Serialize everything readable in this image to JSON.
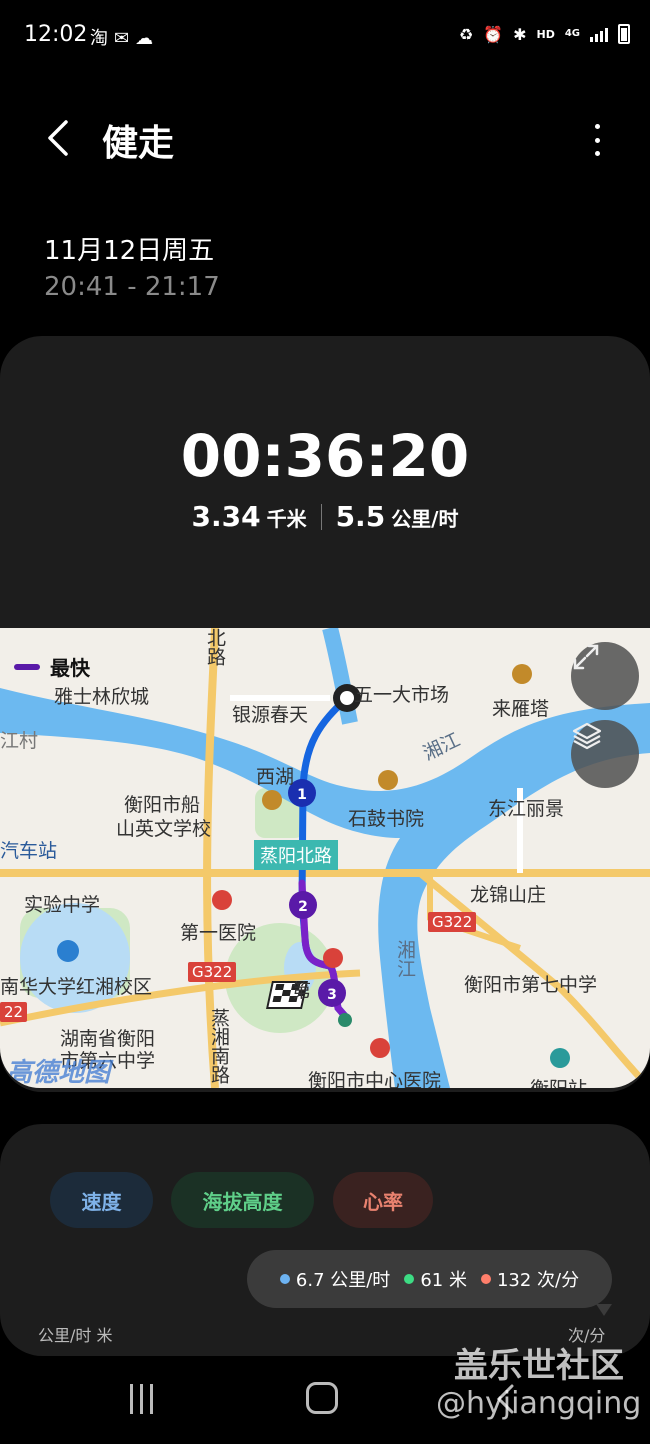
{
  "status_bar": {
    "time": "12:02",
    "left_icons": [
      "taobao-icon",
      "wechat-icon",
      "cloud-icon"
    ],
    "right_icons": [
      "battery-saver-icon",
      "alarm-icon",
      "bluetooth-icon",
      "hd-icon",
      "4g-icon",
      "signal-icon",
      "battery-icon"
    ],
    "hd_label": "HD",
    "network_label": "4G"
  },
  "header": {
    "title": "健走"
  },
  "session": {
    "date": "11月12日周五",
    "time_range": "20:41 - 21:17"
  },
  "stats": {
    "duration": "00:36:20",
    "distance_value": "3.34",
    "distance_unit": "千米",
    "speed_value": "5.5",
    "speed_unit": "公里/时"
  },
  "map": {
    "legend_label": "最快",
    "colors": {
      "route_blue": "#1565e0",
      "route_purple": "#6a1bb0",
      "water": "#4aa8e8",
      "road": "#f4c96a"
    },
    "markers": [
      "1",
      "2",
      "3"
    ],
    "labels": {
      "north_road": "北路",
      "yashilin": "雅士林欣城",
      "yinyuan": "银源春天",
      "wuyi_market": "五一大市场",
      "laiyan_tower": "来雁塔",
      "xiangjiang_1": "湘江",
      "xihu": "西湖",
      "hengyang_chuan": "衡阳市船",
      "shanying": "山英文学校",
      "shigu": "石鼓书院",
      "dongjiang": "东江丽景",
      "qiche_zhan": "汽车站",
      "zhengyang_road": "蒸阳北路",
      "shiyan_middle": "实验中学",
      "first_hospital": "第一医院",
      "longjin": "龙锦山庄",
      "xiangjiang_2": "湘江",
      "g322_a": "G322",
      "g322_b": "G322",
      "g322_c": "22",
      "huada": "南华大学红湘校区",
      "diyi_short": "第",
      "seventh_middle": "衡阳市第七中学",
      "hunan_hengyang": "湖南省衡阳",
      "sixth_middle": "市第六中学",
      "zhengxiang_road": "蒸湘南路",
      "central_hospital": "衡阳市中心医院",
      "hengyang_station": "衡阳站",
      "village": "江村",
      "amap": "高德地图"
    }
  },
  "charts": {
    "chips": {
      "speed": "速度",
      "altitude": "海拔高度",
      "heart_rate": "心率"
    },
    "tooltip": {
      "speed": "6.7 公里/时",
      "altitude": "61 米",
      "heart_rate": "132 次/分",
      "speed_color": "#6db3f2",
      "altitude_color": "#3ddc84",
      "heart_color": "#ff7f6b"
    },
    "axis_left": "公里/时 米",
    "axis_right": "次/分"
  },
  "watermark": {
    "site": "盖乐世社区",
    "handle": "@hyjiangqing"
  }
}
